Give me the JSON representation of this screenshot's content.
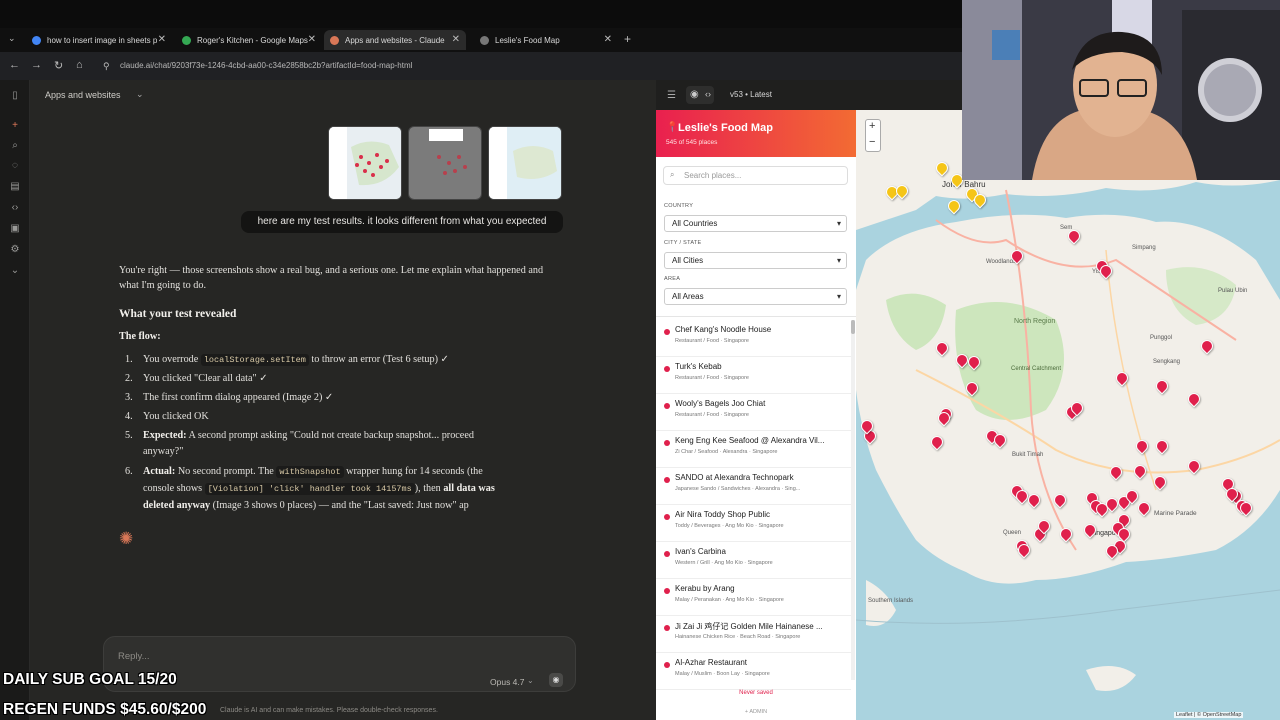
{
  "browser": {
    "tabs": [
      {
        "title": "how to insert image in sheets p",
        "color": "#4285f4"
      },
      {
        "title": "Roger's Kitchen - Google Maps",
        "color": "#34a853"
      },
      {
        "title": "Apps and websites - Claude",
        "color": "#d97757"
      },
      {
        "title": "Leslie's Food Map",
        "color": "#777777"
      }
    ],
    "url": "claude.ai/chat/9203f73e-1246-4cbd-aa00-c34e2858bc2b?artifactId=food-map-html"
  },
  "chat": {
    "project_title": "Apps and websites",
    "user_message": "here are my test results. it looks different from what you expected",
    "intro": "You're right — those screenshots show a real bug, and a serious one. Let me explain what happened and what I'm going to do.",
    "heading": "What your test revealed",
    "flow_label": "The flow:",
    "steps": {
      "s1_num": "1.",
      "s1_a": "You overrode ",
      "s1_code": "localStorage.setItem",
      "s1_b": " to throw an error (Test 6 setup) ✓",
      "s2_num": "2.",
      "s2": "You clicked \"Clear all data\" ✓",
      "s3_num": "3.",
      "s3": "The first confirm dialog appeared (Image 2) ✓",
      "s4_num": "4.",
      "s4": "You clicked OK",
      "s5_num": "5.",
      "s5_bold": "Expected:",
      "s5_a": " A second prompt asking \"Could not create backup snapshot... proceed",
      "s5_b": "anyway?\"",
      "s6_num": "6.",
      "s6_bold": "Actual:",
      "s6_a": " No second prompt. The ",
      "s6_code1": "withSnapshot",
      "s6_b": " wrapper hung for 14 seconds (the",
      "s6_c": "console shows ",
      "s6_code2": "[Violation] 'click' handler took 14157ms",
      "s6_d": "), then ",
      "s6_bold2": "all data was",
      "s6_bold3": "deleted anyway",
      "s6_e": " (Image 3 shows 0 places) — and the \"Last saved: Just now\" ap"
    },
    "reply_placeholder": "Reply...",
    "model": "Opus 4.7",
    "disclaimer": "Claude is AI and can make mistakes. Please double-check responses."
  },
  "artifact": {
    "version": "v53 • Latest",
    "app_title": "Leslie's Food Map",
    "count": "545 of 545 places",
    "search_placeholder": "Search places...",
    "filters": {
      "country_label": "COUNTRY",
      "country_value": "All Countries",
      "city_label": "CITY / STATE",
      "city_value": "All Cities",
      "area_label": "AREA",
      "area_value": "All Areas"
    },
    "places": [
      {
        "name": "Chef Kang's Noodle House",
        "sub": "Restaurant / Food · Singapore"
      },
      {
        "name": "Turk's Kebab",
        "sub": "Restaurant / Food · Singapore"
      },
      {
        "name": "Wooly's Bagels Joo Chiat",
        "sub": "Restaurant / Food · Singapore"
      },
      {
        "name": "Keng Eng Kee Seafood @ Alexandra Vil...",
        "sub": "Zi Char / Seafood · Alexandra · Singapore"
      },
      {
        "name": "SANDO at Alexandra Technopark",
        "sub": "Japanese Sando / Sandwiches · Alexandra · Sing..."
      },
      {
        "name": "Air Nira Toddy Shop Public",
        "sub": "Toddy / Beverages · Ang Mo Kio · Singapore"
      },
      {
        "name": "Ivan's Carbina",
        "sub": "Western / Grill · Ang Mo Kio · Singapore"
      },
      {
        "name": "Kerabu by Arang",
        "sub": "Malay / Peranakan · Ang Mo Kio · Singapore"
      },
      {
        "name": "Ji Zai Ji 鸡仔记 Golden Mile Hainanese ...",
        "sub": "Hainanese Chicken Rice · Beach Road · Singapore"
      },
      {
        "name": "Al-Azhar Restaurant",
        "sub": "Malay / Muslim · Boon Lay · Singapore"
      }
    ],
    "footer_saved": "Never saved",
    "footer_admin": "+ ADMIN",
    "map_labels": {
      "johor": "Johor Bahru",
      "north_region": "North Region",
      "woodlands": "Woodlands",
      "yishun": "Yishun",
      "sembawang": "Sem",
      "simpang": "Simpang",
      "pulau_ubin": "Pulau Ubin",
      "punggol": "Punggol",
      "sengkang": "Sengkang",
      "central_catchment": "Central Catchment",
      "bukit_timah": "Bukit Timah",
      "queenstown": "Queen",
      "singapore": "Singapore",
      "marine_parade": "Marine Parade",
      "southern_islands": "Southern Islands",
      "attribution": "Leaflet | © OpenStreetMap"
    },
    "zoom_in": "+",
    "zoom_out": "−"
  },
  "overlay": {
    "sub_goal": "DAILY SUB GOAL 15/20",
    "regen": "REGEN FUNDS $45.60/$200"
  },
  "colors": {
    "accent": "#e0204c",
    "claude_orange": "#d97757",
    "pin_yellow": "#f5c518"
  }
}
